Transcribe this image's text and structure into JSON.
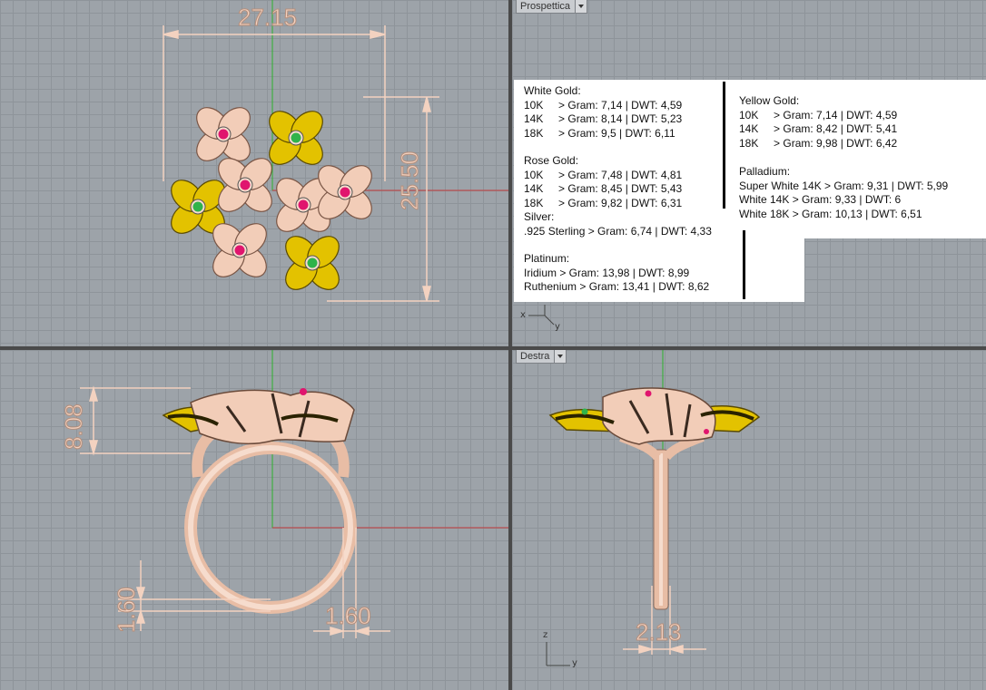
{
  "viewports": {
    "perspective_label": "Prospettica",
    "right_label": "Destra"
  },
  "dimensions": {
    "top_width": "27.15",
    "top_height": "25.50",
    "front_height": "8.08",
    "front_band_thickness": "1.60",
    "front_band_width": "1.60",
    "right_width": "2.13"
  },
  "weights_left": {
    "white_gold_title": "White Gold:",
    "white_gold": [
      "10K     > Gram: 7,14 | DWT: 4,59",
      "14K     > Gram: 8,14 | DWT: 5,23",
      "18K     > Gram: 9,5 | DWT: 6,11"
    ],
    "rose_gold_title": "Rose Gold:",
    "rose_gold": [
      "10K     > Gram: 7,48 | DWT: 4,81",
      "14K     > Gram: 8,45 | DWT: 5,43",
      "18K     > Gram: 9,82 | DWT: 6,31"
    ],
    "silver_title": "Silver:",
    "silver": [
      ".925 Sterling > Gram: 6,74 | DWT: 4,33"
    ],
    "platinum_title": "Platinum:",
    "platinum": [
      "Iridium > Gram: 13,98 | DWT: 8,99",
      "Ruthenium > Gram: 13,41 | DWT: 8,62"
    ]
  },
  "weights_right": {
    "yellow_gold_title": "Yellow Gold:",
    "yellow_gold": [
      "10K     > Gram: 7,14 | DWT: 4,59",
      "14K     > Gram: 8,42 | DWT: 5,41",
      "18K     > Gram: 9,98 | DWT: 6,42"
    ],
    "palladium_title": "Palladium:",
    "palladium": [
      "Super White 14K > Gram: 9,31 | DWT: 5,99",
      "White 14K > Gram: 9,33 | DWT: 6",
      "White 18K > Gram: 10,13 | DWT: 6,51"
    ]
  },
  "axes": {
    "x": "x",
    "y": "y",
    "z": "z"
  },
  "colors": {
    "rose_metal": "#f2cdb8",
    "yellow_metal": "#e3c200",
    "ruby": "#e0156e",
    "emerald": "#2fb34a",
    "dimension": "#f3d2c0"
  }
}
